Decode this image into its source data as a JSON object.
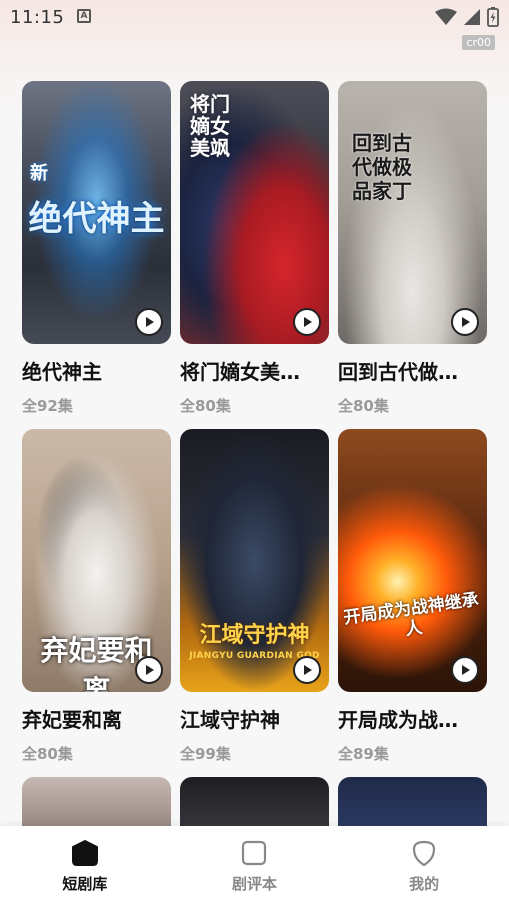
{
  "status_bar": {
    "time": "11:15",
    "badge": "cr00"
  },
  "dramas": [
    {
      "title": "绝代神主",
      "episodes": "全92集",
      "poster_text": "绝代神主",
      "poster_sub": "新"
    },
    {
      "title": "将门嫡女美…",
      "episodes": "全80集",
      "poster_text": "将门嫡女美飒",
      "poster_sub": ""
    },
    {
      "title": "回到古代做…",
      "episodes": "全80集",
      "poster_text": "回到古代做极品家丁",
      "poster_sub": ""
    },
    {
      "title": "弃妃要和离",
      "episodes": "全80集",
      "poster_text": "弃妃要和离",
      "poster_sub": ""
    },
    {
      "title": "江域守护神",
      "episodes": "全99集",
      "poster_text": "江域守护神",
      "poster_sub": "JIANGYU GUARDIAN GOD"
    },
    {
      "title": "开局成为战…",
      "episodes": "全89集",
      "poster_text": "开局成为战神继承人",
      "poster_sub": ""
    }
  ],
  "nav": {
    "items": [
      {
        "label": "短剧库",
        "icon": "hexagon-icon",
        "active": true
      },
      {
        "label": "剧评本",
        "icon": "square-icon",
        "active": false
      },
      {
        "label": "我的",
        "icon": "shield-icon",
        "active": false
      }
    ]
  },
  "colors": {
    "active_nav": "#111111",
    "inactive_nav": "#888888",
    "episodes_text": "#9a9a9a"
  }
}
